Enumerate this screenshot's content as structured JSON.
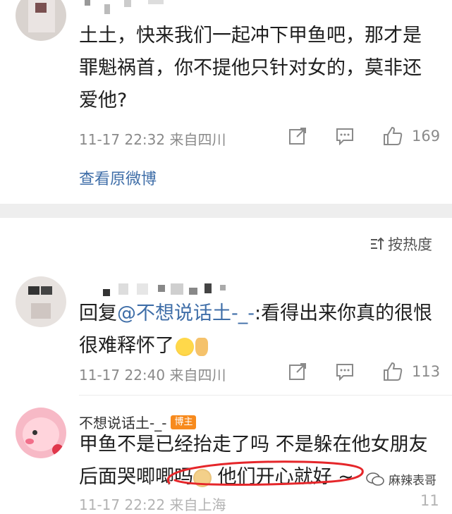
{
  "comment1": {
    "text": "土土，快来我们一起冲下甲鱼吧，那才是罪魁祸首，你不提他只针对女的，莫非还爱他?",
    "meta": "11-17 22:32 来自四川",
    "likes": "169",
    "view_original": "查看原微博"
  },
  "sort": {
    "label": "按热度"
  },
  "reply1": {
    "prefix": "回复",
    "mention": "@不想说话土-_-",
    "text": ":看得出来你真的很恨很难释怀了",
    "meta": "11-17 22:40 来自四川",
    "likes": "113"
  },
  "reply2": {
    "username": "不想说话土-_-",
    "badge": "博主",
    "text_line1": "甲鱼不是已经抬走了吗 不是躲在他女朋友",
    "text_line2a": "后面哭唧唧吗",
    "text_line2b": " 他们开心就好 ~",
    "meta_partial": "11-17 22:22 来自上海",
    "likes_partial": "11"
  },
  "watermark": {
    "text": "麻辣表哥"
  },
  "colors": {
    "accent_link": "#3f6ea8",
    "badge": "#f78a1d",
    "annotation": "#e5262a"
  }
}
